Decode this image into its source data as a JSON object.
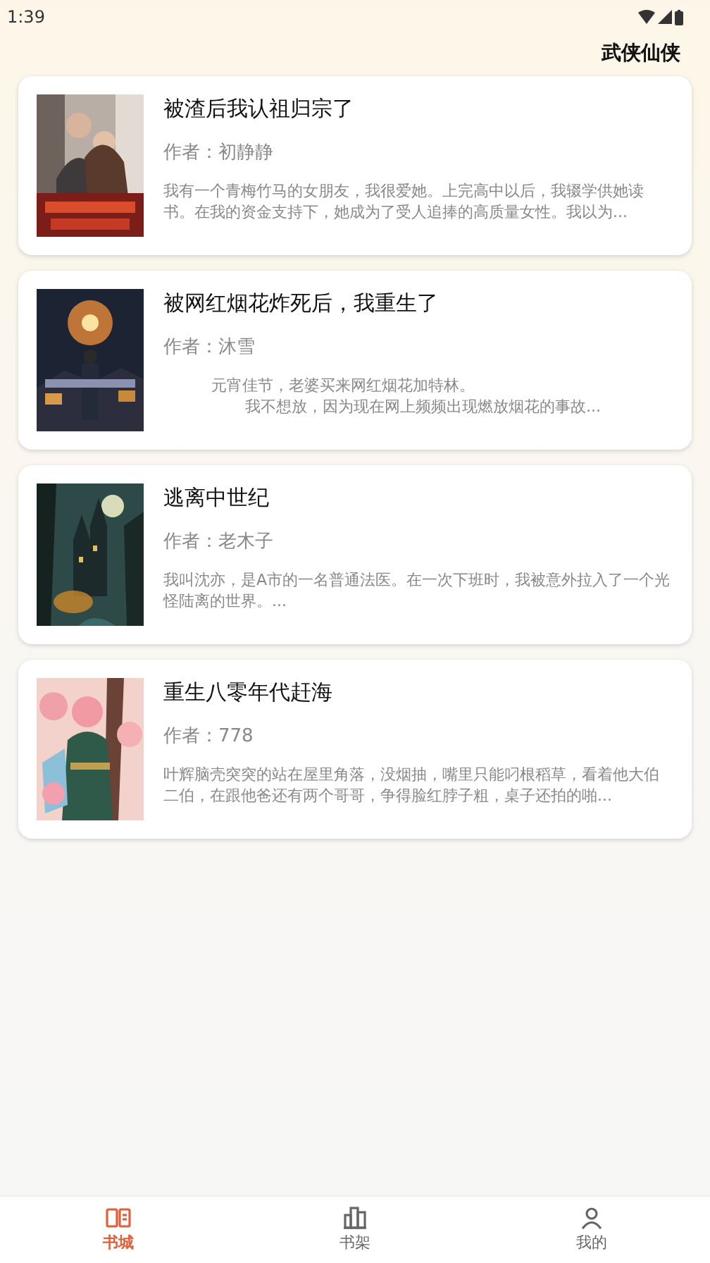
{
  "status_bar": {
    "time": "1:39"
  },
  "header": {
    "category": "武侠仙侠"
  },
  "books": [
    {
      "title": "被渣后我认祖归宗了",
      "author": "作者：初静静",
      "paragraphs": [
        "我有一个青梅竹马的女朋友，我很爱她。上完高中以后，我辍学供她读书。在我的资金支持下，她成为了受人追捧的高质量女性。我以为..."
      ],
      "cover": {
        "kind": "picture"
      }
    },
    {
      "title": "被网红烟花炸死后，我重生了",
      "author": "作者：沐雪",
      "paragraphs": [
        "元宵佳节，老婆买来网红烟花加特林。",
        "我不想放，因为现在网上频频出现燃放烟花的事故..."
      ],
      "cover": {
        "kind": "picture"
      }
    },
    {
      "title": "逃离中世纪",
      "author": "作者：老木子",
      "paragraphs": [
        "我叫沈亦，是A市的一名普通法医。在一次下班时，我被意外拉入了一个光怪陆离的世界。..."
      ],
      "cover": {
        "kind": "picture"
      }
    },
    {
      "title": "重生八零年代赶海",
      "author": "作者：778",
      "paragraphs": [
        "叶辉脑壳突突的站在屋里角落，没烟抽，嘴里只能叼根稻草，看着他大伯二伯，在跟他爸还有两个哥哥，争得脸红脖子粗，桌子还拍的啪..."
      ],
      "cover": {
        "kind": "picture"
      }
    }
  ],
  "nav": [
    {
      "label": "书城",
      "selected": true
    },
    {
      "label": "书架",
      "selected": false
    },
    {
      "label": "我的",
      "selected": false
    }
  ]
}
